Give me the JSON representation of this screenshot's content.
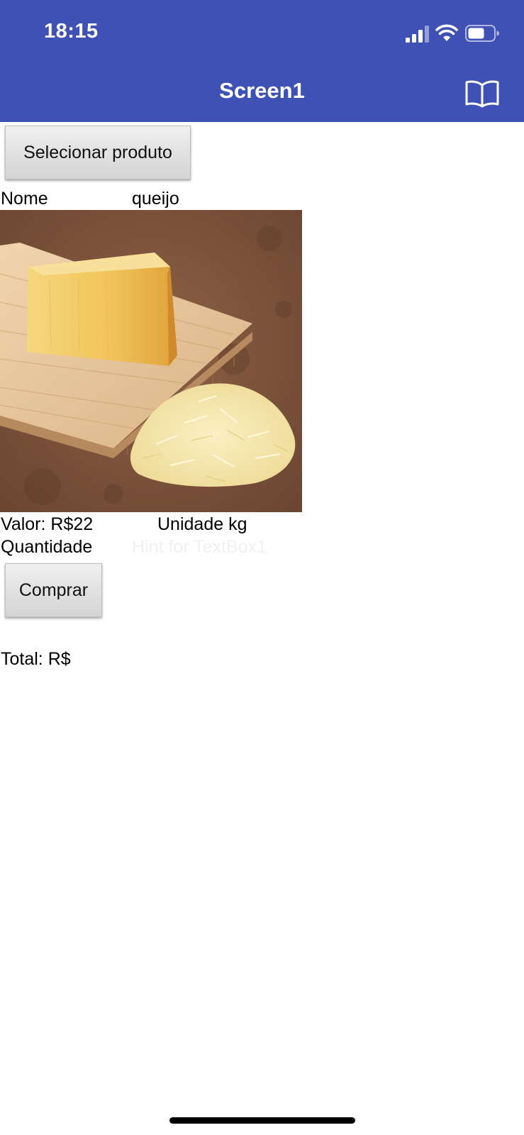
{
  "status_bar": {
    "time": "18:15",
    "icons": [
      "cellular-signal-icon",
      "wifi-icon",
      "battery-icon"
    ]
  },
  "app_bar": {
    "title": "Screen1",
    "action_icon": "book-icon",
    "background_color": "#3f51b5",
    "text_color": "#ffffff"
  },
  "content": {
    "select_button_label": "Selecionar produto",
    "name_label": "Nome",
    "name_value": "queijo",
    "product_image_alt": "cheese",
    "price_label": "Valor: R$22",
    "unit_label": "Unidade kg",
    "quantity_label": "Quantidade",
    "quantity_input": {
      "value": "",
      "placeholder": "Hint for TextBox1"
    },
    "buy_button_label": "Comprar",
    "total_label": "Total: R$"
  }
}
